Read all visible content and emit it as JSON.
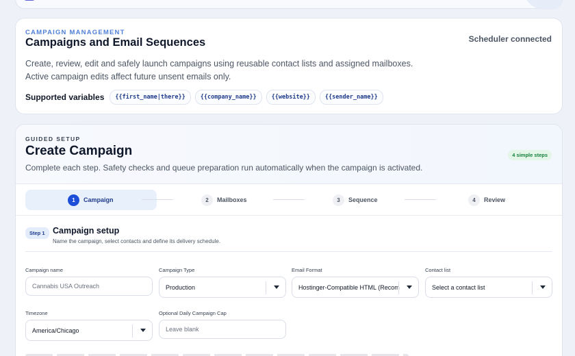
{
  "management": {
    "eyebrow": "CAMPAIGN MANAGEMENT",
    "title": "Campaigns and Email Sequences",
    "status": "Scheduler connected",
    "description": "Create, review, edit and safely launch campaigns using reusable contact lists and assigned mailboxes. Active campaign edits affect future unsent emails only.",
    "variables_label": "Supported variables",
    "variables": [
      "{{first_name|there}}",
      "{{company_name}}",
      "{{website}}",
      "{{sender_name}}"
    ]
  },
  "create": {
    "eyebrow": "GUIDED SETUP",
    "title": "Create Campaign",
    "description": "Complete each step. Safety checks and queue preparation run automatically when the campaign is activated.",
    "steps_badge": "4 simple steps",
    "steps": [
      {
        "num": "1",
        "label": "Campaign"
      },
      {
        "num": "2",
        "label": "Mailboxes"
      },
      {
        "num": "3",
        "label": "Sequence"
      },
      {
        "num": "4",
        "label": "Review"
      }
    ]
  },
  "setup": {
    "tag": "Step 1",
    "title": "Campaign setup",
    "subtitle": "Name the campaign, select contacts and define its delivery schedule.",
    "fields": {
      "campaign_name": {
        "label": "Campaign name",
        "placeholder": "Cannabis USA Outreach"
      },
      "campaign_type": {
        "label": "Campaign Type",
        "value": "Production"
      },
      "email_format": {
        "label": "Email Format",
        "value": "Hostinger-Compatible HTML (Recom"
      },
      "contact_list": {
        "label": "Contact list",
        "value": "Select a contact list"
      },
      "timezone": {
        "label": "Timezone",
        "value": "America/Chicago"
      },
      "daily_cap": {
        "label": "Optional Daily Campaign Cap",
        "placeholder": "Leave blank"
      }
    }
  },
  "colors": {
    "accent": "#1d4ed8",
    "eyebrow": "#4f7fd8",
    "badge_green": "#15803d"
  }
}
